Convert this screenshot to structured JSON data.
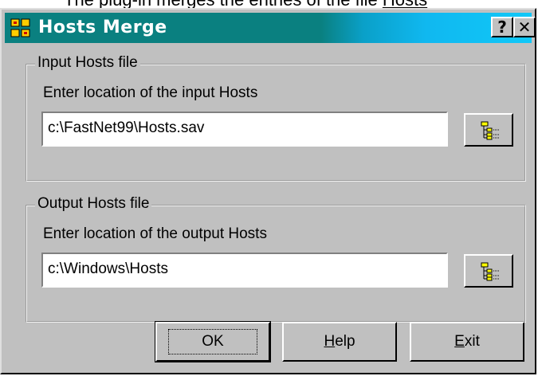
{
  "background_caption": {
    "prefix": "The plug-in merges the entries of the file ",
    "link": "Hosts"
  },
  "window": {
    "title": "Hosts Merge",
    "help_button": "?",
    "close_button": "✕"
  },
  "input_group": {
    "legend": "Input Hosts file",
    "prompt": "Enter location of the input Hosts",
    "value": "c:\\FastNet99\\Hosts.sav",
    "browse_icon": "folder-tree-icon"
  },
  "output_group": {
    "legend": "Output Hosts file",
    "prompt": "Enter location of the output Hosts",
    "value": "c:\\Windows\\Hosts",
    "browse_icon": "folder-tree-icon"
  },
  "buttons": {
    "ok": "OK",
    "help_mnemonic": "H",
    "help_rest": "elp",
    "exit_mnemonic": "E",
    "exit_rest": "xit"
  },
  "colors": {
    "dialog_face": "#c0c0c0",
    "titlebar_left": "#0a8080",
    "titlebar_right": "#10c8f8",
    "title_text": "#ffffff"
  }
}
